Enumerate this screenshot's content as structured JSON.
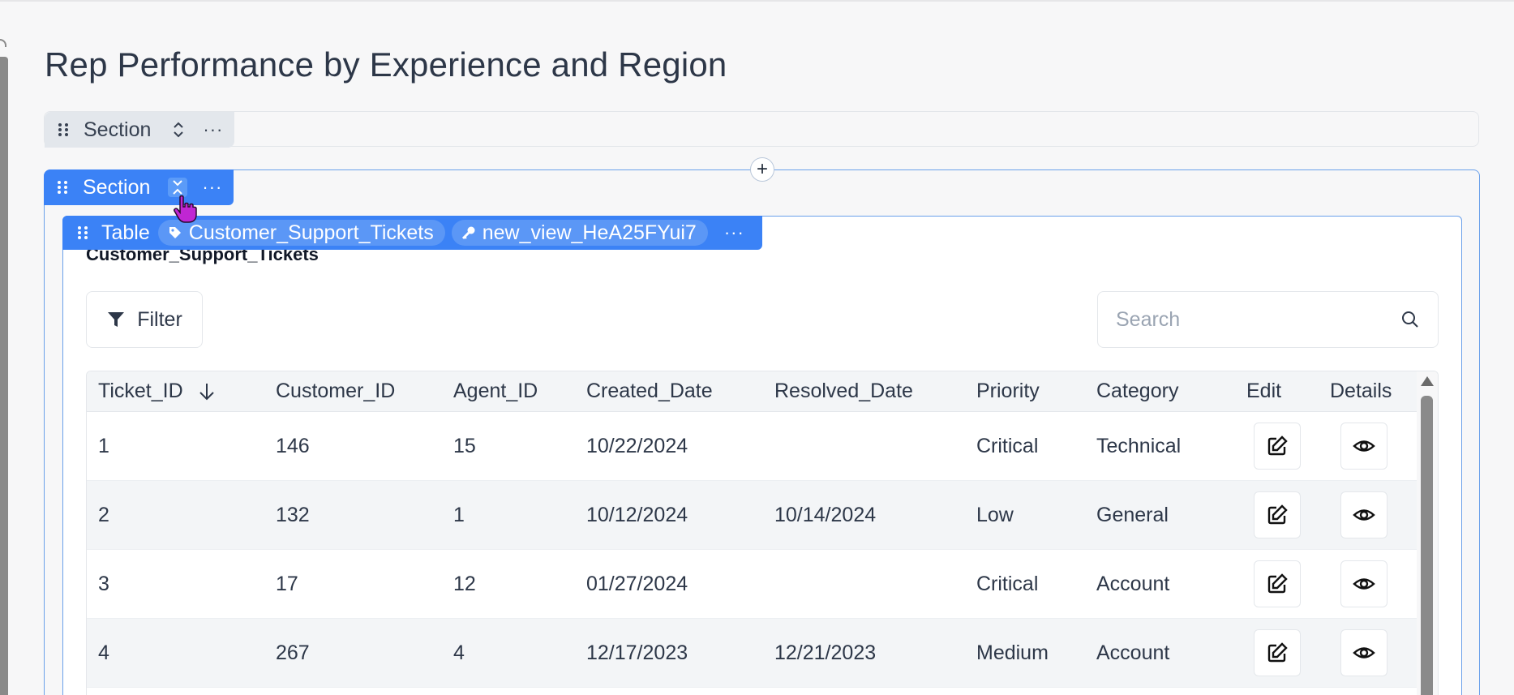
{
  "page": {
    "title": "Rep Performance by Experience and Region"
  },
  "sections": {
    "collapsed": {
      "label": "Section",
      "more": "···"
    },
    "expanded": {
      "label": "Section",
      "more": "···"
    },
    "add_symbol": "+"
  },
  "table_widget": {
    "type_label": "Table",
    "source_tag": "Customer_Support_Tickets",
    "view_tag": "new_view_HeA25FYui7",
    "more": "···",
    "heading": "Customer_Support_Tickets",
    "filter_label": "Filter",
    "search_placeholder": "Search",
    "columns": [
      "Ticket_ID",
      "Customer_ID",
      "Agent_ID",
      "Created_Date",
      "Resolved_Date",
      "Priority",
      "Category",
      "Edit",
      "Details"
    ],
    "sort": {
      "column": "Ticket_ID",
      "direction": "descending-arrow"
    },
    "rows": [
      {
        "Ticket_ID": "1",
        "Customer_ID": "146",
        "Agent_ID": "15",
        "Created_Date": "10/22/2024",
        "Resolved_Date": "",
        "Priority": "Critical",
        "Category": "Technical"
      },
      {
        "Ticket_ID": "2",
        "Customer_ID": "132",
        "Agent_ID": "1",
        "Created_Date": "10/12/2024",
        "Resolved_Date": "10/14/2024",
        "Priority": "Low",
        "Category": "General"
      },
      {
        "Ticket_ID": "3",
        "Customer_ID": "17",
        "Agent_ID": "12",
        "Created_Date": "01/27/2024",
        "Resolved_Date": "",
        "Priority": "Critical",
        "Category": "Account"
      },
      {
        "Ticket_ID": "4",
        "Customer_ID": "267",
        "Agent_ID": "4",
        "Created_Date": "12/17/2023",
        "Resolved_Date": "12/21/2023",
        "Priority": "Medium",
        "Category": "Account"
      }
    ]
  },
  "icons": {
    "grip": "drag-grip-icon",
    "chevron_collapsed": "chevron-up-down-icon",
    "chevron_expanded": "chevron-collapse-icon",
    "tag": "tag-icon",
    "key": "key-icon",
    "filter": "funnel-icon",
    "search": "magnifier-icon",
    "edit": "edit-pencil-icon",
    "details": "eye-icon"
  },
  "colors": {
    "accent": "#3b82f6",
    "accent_light": "#5b97f6",
    "cursor": "#c026d3"
  }
}
